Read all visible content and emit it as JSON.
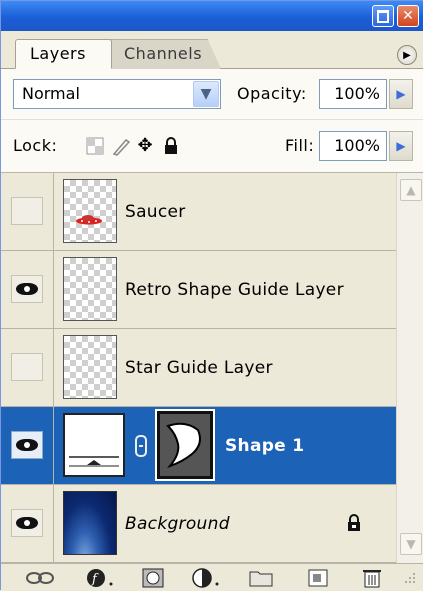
{
  "window": {
    "minimize_icon": "minimize-icon",
    "close_icon": "close-icon"
  },
  "tabs": [
    {
      "label": "Layers",
      "active": true
    },
    {
      "label": "Channels",
      "active": false
    }
  ],
  "blend": {
    "mode": "Normal",
    "opacity_label": "Opacity:",
    "opacity_value": "100%"
  },
  "lock": {
    "label": "Lock:",
    "fill_label": "Fill:",
    "fill_value": "100%"
  },
  "layers": [
    {
      "name": "Saucer",
      "visible": false,
      "thumb": "saucer"
    },
    {
      "name": "Retro Shape Guide Layer",
      "visible": true,
      "thumb": "transparent"
    },
    {
      "name": "Star Guide Layer",
      "visible": false,
      "thumb": "transparent"
    },
    {
      "name": "Shape 1",
      "visible": true,
      "selected": true,
      "thumb": "shape-with-mask"
    },
    {
      "name": "Background",
      "visible": true,
      "locked": true,
      "thumb": "earth"
    }
  ],
  "colors": {
    "selection": "#1c63b7",
    "titlebar": "#1b5fd6",
    "panel": "#ece9d8"
  }
}
